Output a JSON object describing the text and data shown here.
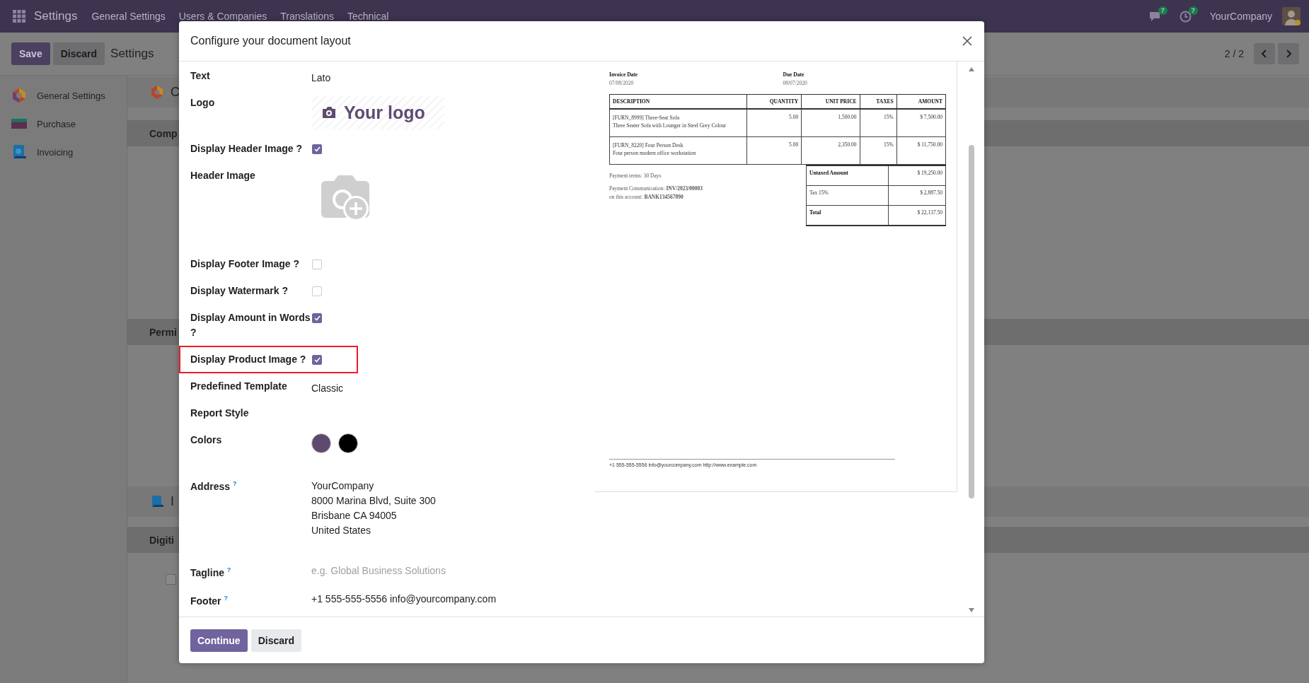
{
  "navbar": {
    "app": "Settings",
    "menus": [
      "General Settings",
      "Users & Companies",
      "Translations",
      "Technical"
    ],
    "messages_badge": "7",
    "activities_badge": "7",
    "company": "YourCompany"
  },
  "control_panel": {
    "buttons": [
      {
        "label": "Save",
        "primary": true
      },
      {
        "label": "Discard",
        "primary": false
      }
    ],
    "title": "Settings",
    "pager": "2 / 2"
  },
  "sidebar": {
    "items": [
      {
        "label": "General Settings",
        "selected": false
      },
      {
        "label": "Purchase",
        "selected": false
      },
      {
        "label": "Invoicing",
        "selected": false
      }
    ]
  },
  "background_sections": [
    {
      "kind": "app-title",
      "text": "C"
    },
    {
      "kind": "section",
      "text": "Comp"
    },
    {
      "kind": "section",
      "text": "Permi"
    },
    {
      "kind": "app-title",
      "text": "I"
    },
    {
      "kind": "section",
      "text": "Digiti"
    },
    {
      "kind": "checkbox",
      "checked": false
    }
  ],
  "dialog": {
    "title": "Configure your document layout",
    "fields": [
      {
        "kind": "text",
        "label": "Text",
        "value": "Lato"
      },
      {
        "kind": "logo",
        "label": "Logo",
        "value": "Your logo"
      },
      {
        "kind": "checkbox",
        "label": "Display Header Image ?",
        "checked": true,
        "highlighted": false
      },
      {
        "kind": "image",
        "label": "Header Image"
      },
      {
        "kind": "checkbox",
        "label": "Display Footer Image ?",
        "checked": false,
        "highlighted": false
      },
      {
        "kind": "checkbox",
        "label": "Display Watermark ?",
        "checked": false,
        "highlighted": false
      },
      {
        "kind": "checkbox",
        "label": "Display Amount in Words ?",
        "checked": true,
        "highlighted": false
      },
      {
        "kind": "checkbox",
        "label": "Display Product Image ?",
        "checked": true,
        "highlighted": true
      },
      {
        "kind": "text",
        "label": "Predefined Template",
        "value": "Classic"
      },
      {
        "kind": "text",
        "label": "Report Style"
      },
      {
        "kind": "colors",
        "label": "Colors",
        "colors": [
          {
            "color": "#5e4a6e"
          },
          {
            "color": "#000000"
          }
        ]
      },
      {
        "kind": "address",
        "label": "Address $^{?}$",
        "lines": [
          "YourCompany",
          "8000 Marina Blvd, Suite 300",
          "Brisbane CA 94005",
          "United States"
        ]
      },
      {
        "kind": "input",
        "label": "Tagline $^{?}$",
        "placeholder": "e.g. Global Business Solutions"
      },
      {
        "kind": "input",
        "label": "Footer $^{?}$",
        "value": "+1 555-555-5556 info@yourcompany.com"
      }
    ],
    "buttons": [
      {
        "label": "Continue",
        "primary": true
      },
      {
        "label": "Discard",
        "primary": false
      }
    ]
  },
  "invoice_preview": {
    "invoice_date_label": "Invoice Date",
    "invoice_date": "07/08/2020",
    "due_date_label": "Due Date",
    "due_date": "08/07/2020",
    "columns": [
      "DESCRIPTION",
      "QUANTITY",
      "UNIT PRICE",
      "TAXES",
      "AMOUNT"
    ],
    "rows": [
      {
        "description": "[FURN_8999] Three-Seat Sofa",
        "note": "Three Seater Sofa with Lounger in Steel Grey Colour",
        "quantity": "5.00",
        "unit_price": "1,500.00",
        "taxes": "15%",
        "amount": "$ 7,500.00"
      },
      {
        "description": "[FURN_8220] Four Person Desk",
        "note": "Four person modern office workstation",
        "quantity": "5.00",
        "unit_price": "2,350.00",
        "taxes": "15%",
        "amount": "$ 11,750.00"
      }
    ],
    "payment_terms": "Payment terms: 30 Days",
    "payment_communication": "Payment Communication: **INV/2023/00003**",
    "account": "on this account: **BANK134567890**",
    "totals": [
      {
        "label": "Untaxed Amount",
        "value": "$ 19,250.00",
        "bold": true
      },
      {
        "label": "Tax 15%",
        "value": "$ 2,887.50",
        "bold": false
      },
      {
        "label": "Total",
        "value": "$ 22,137.50",
        "bold": true
      }
    ],
    "footer": "+1 555-555-5556 info@yourcompany.com http://www.example.com"
  }
}
